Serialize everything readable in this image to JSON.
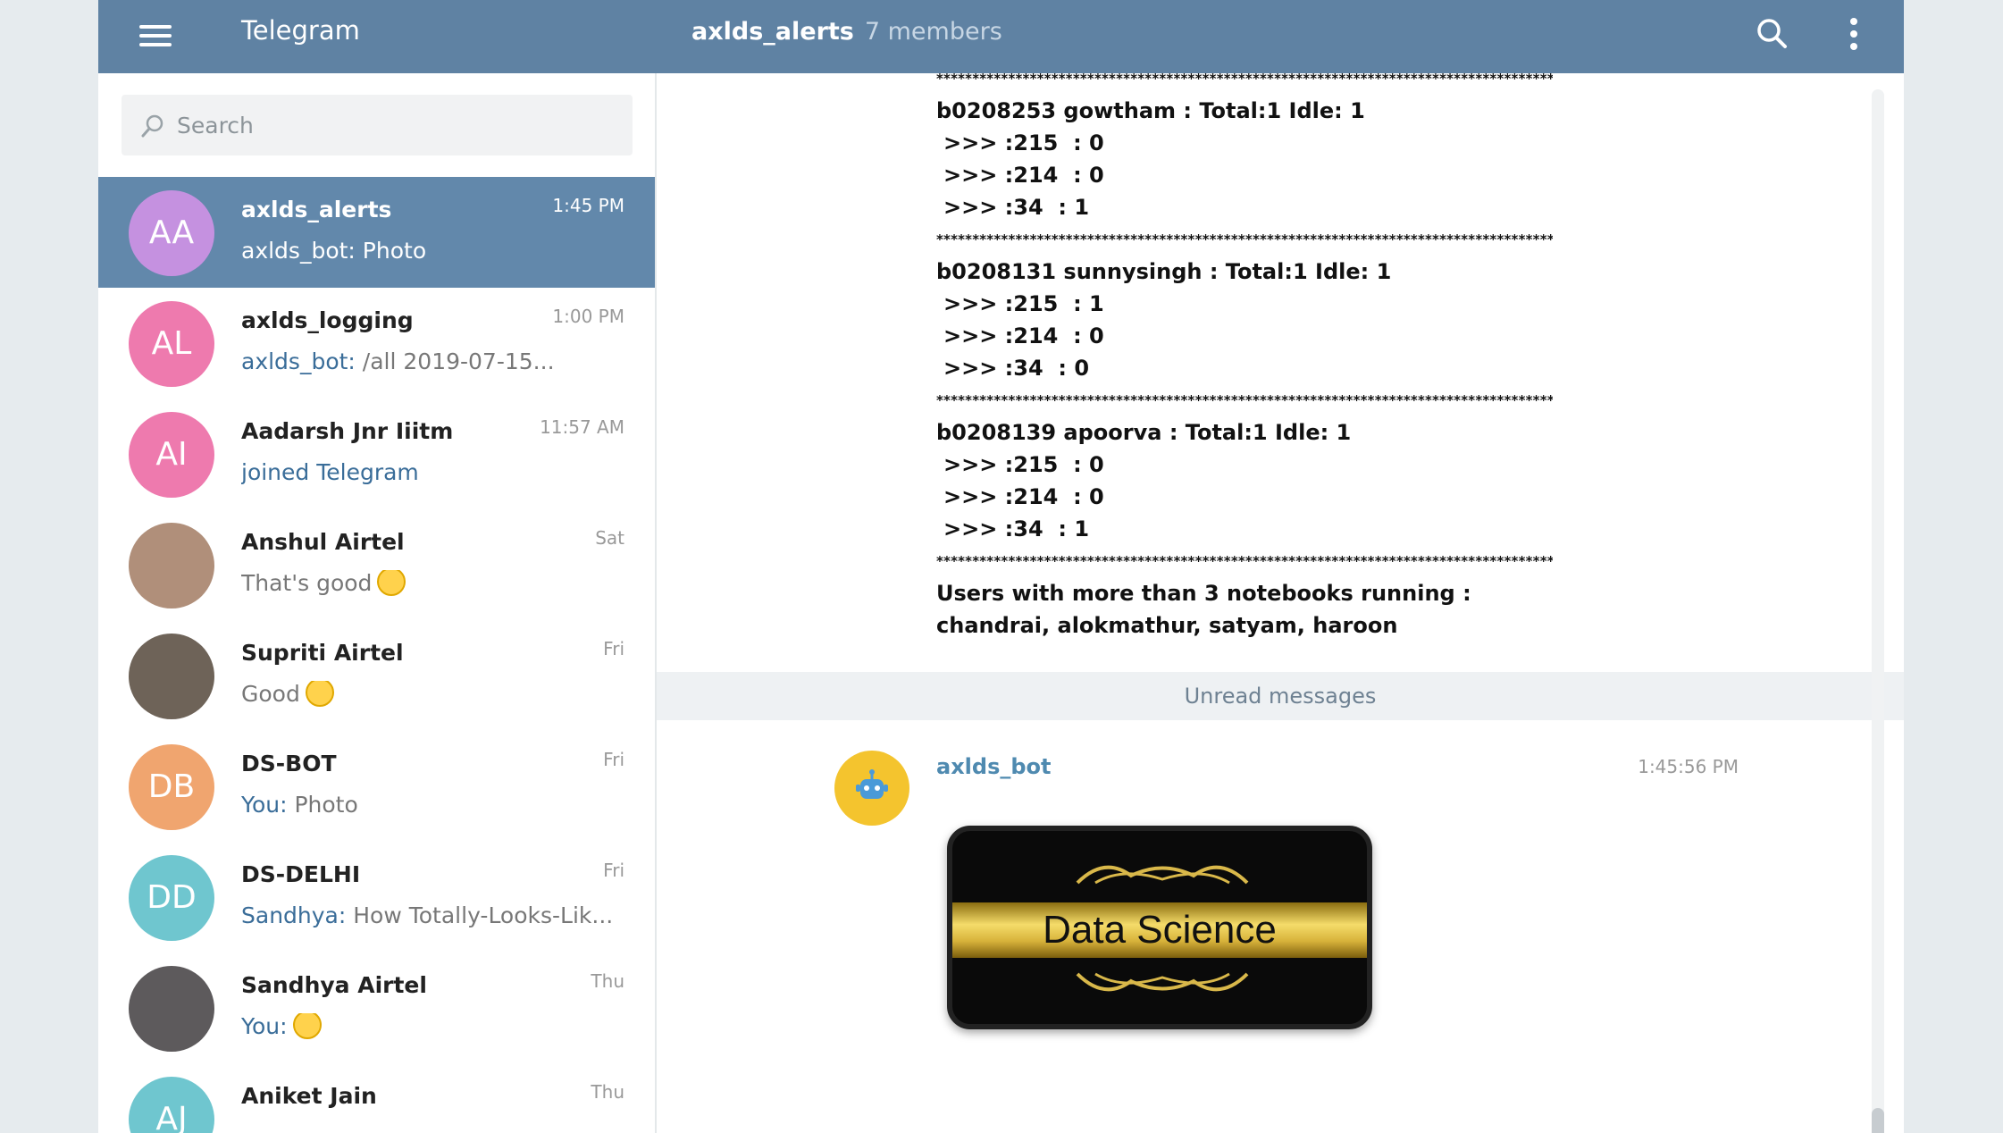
{
  "app": {
    "title": "Telegram",
    "chat_title": "axlds_alerts",
    "chat_members": "7 members"
  },
  "search": {
    "placeholder": "Search"
  },
  "chats": [
    {
      "initials": "AA",
      "color": "#c591e0",
      "name": "axlds_alerts",
      "time": "1:45 PM",
      "sender": "axlds_bot:",
      "preview": " Photo",
      "active": true
    },
    {
      "initials": "AL",
      "color": "#ee7aae",
      "name": "axlds_logging",
      "time": "1:00 PM",
      "sender": "axlds_bot:",
      "preview": " /all 2019-07-15..."
    },
    {
      "initials": "AI",
      "color": "#ee7aae",
      "name": "Aadarsh Jnr Iiitm",
      "time": "11:57 AM",
      "sender": "joined Telegram",
      "preview": ""
    },
    {
      "initials": "",
      "color": "#b08f7a",
      "name": "Anshul Airtel",
      "time": "Sat",
      "sender": "",
      "preview": "That's good",
      "emoji": "grinning-emoji"
    },
    {
      "initials": "",
      "color": "#6e6358",
      "name": "Supriti Airtel",
      "time": "Fri",
      "sender": "",
      "preview": "Good",
      "emoji": "grimacing-emoji"
    },
    {
      "initials": "DB",
      "color": "#f0a56f",
      "name": "DS-BOT",
      "time": "Fri",
      "sender": "You:",
      "preview": " Photo"
    },
    {
      "initials": "DD",
      "color": "#6fc6cf",
      "name": "DS-DELHI",
      "time": "Fri",
      "sender": "Sandhya:",
      "preview": " How Totally-Looks-Lik..."
    },
    {
      "initials": "",
      "color": "#5d5a5c",
      "name": "Sandhya Airtel",
      "time": "Thu",
      "sender": "You:",
      "preview": "",
      "emoji": "crying-emoji"
    },
    {
      "initials": "AJ",
      "color": "#6fc6cf",
      "name": "Aniket Jain",
      "time": "Thu",
      "sender": "",
      "preview": ""
    }
  ],
  "messages": {
    "stars": "************************************************************************************************",
    "groups": [
      {
        "header": "b0208253 gowtham :  Total:1 Idle: 1",
        "lines": [
          ">>> :215  : 0",
          ">>> :214  : 0",
          ">>> :34  : 1"
        ]
      },
      {
        "header": "b0208131 sunnysingh :  Total:1 Idle: 1",
        "lines": [
          ">>> :215  : 1",
          ">>> :214  : 0",
          ">>> :34  : 0"
        ]
      },
      {
        "header": "b0208139 apoorva :  Total:1 Idle: 1",
        "lines": [
          ">>> :215  : 0",
          ">>> :214  : 0",
          ">>> :34  : 1"
        ]
      }
    ],
    "summary": "Users with more than  3 notebooks running : chandrai, alokmathur, satyam, haroon",
    "unread_label": "Unread messages",
    "bot_sender": "axlds_bot",
    "bot_time": "1:45:56 PM",
    "photo_caption": "Data Science"
  },
  "colors": {
    "topbar": "#5f82a3",
    "active_chat": "#6288ab",
    "link": "#3a6d99"
  }
}
